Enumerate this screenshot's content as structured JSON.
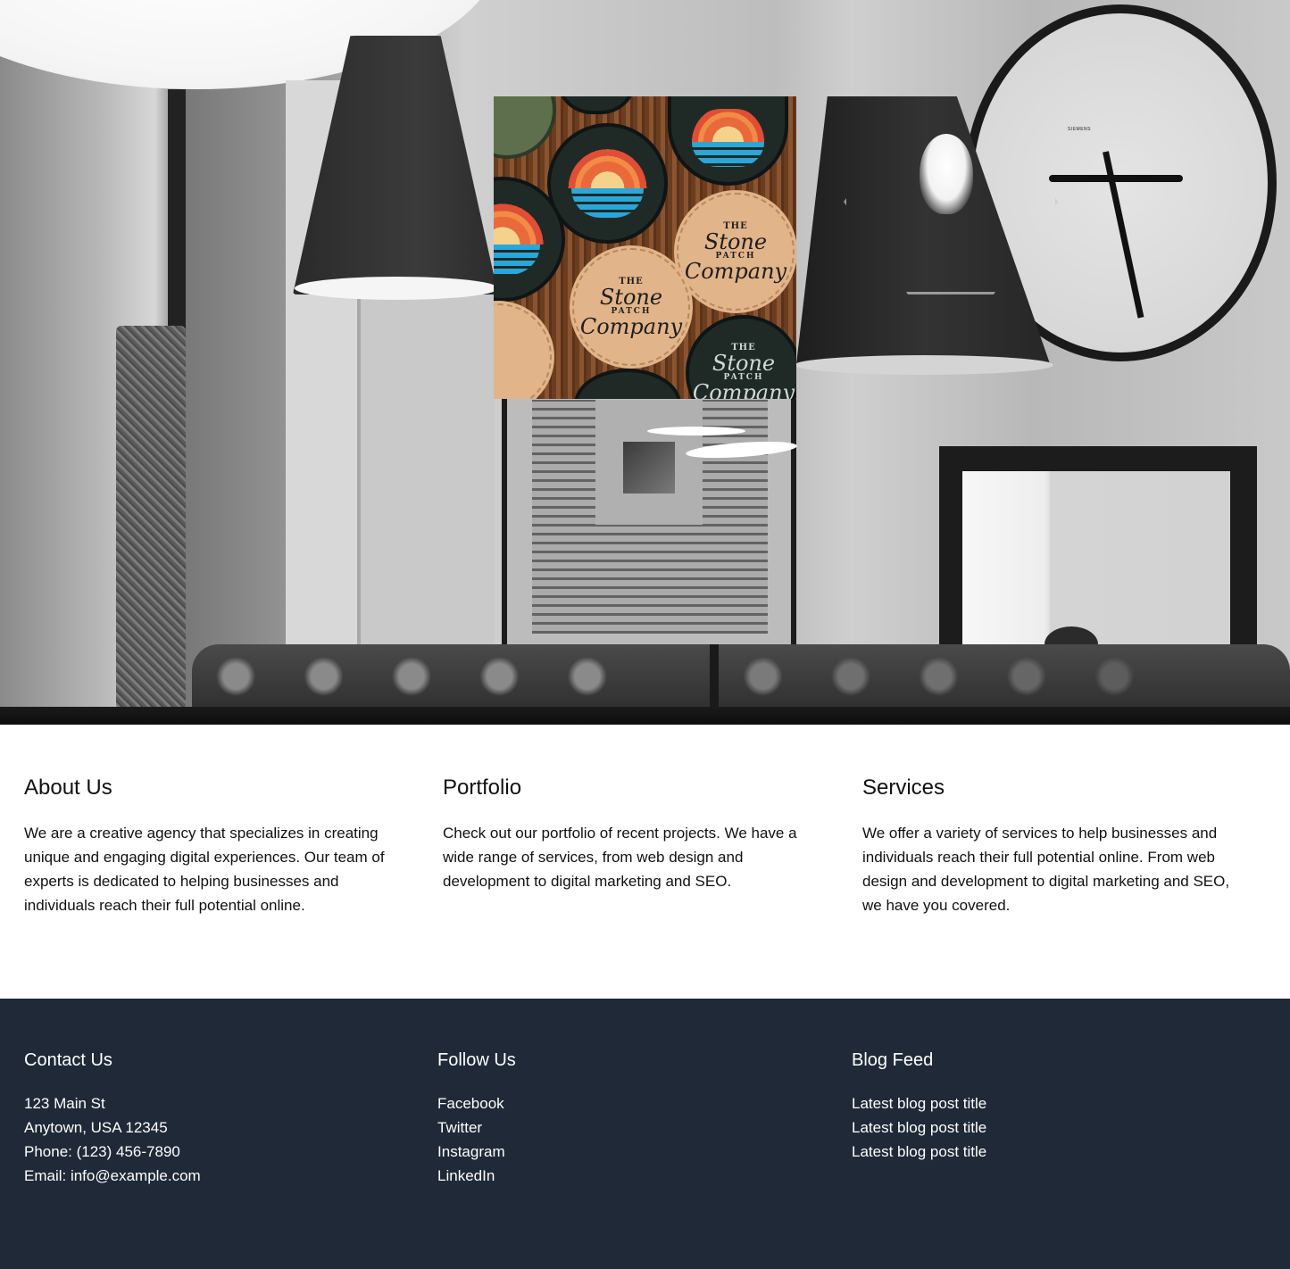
{
  "hero": {
    "background": "black-and-white interior photo with pendant lamps, wall clock, framed art, mirror and sofa",
    "clock_brand": "SIEMENS",
    "logo": {
      "alt": "The Stone Patch Company patches",
      "patch_the": "THE",
      "patch_name": "Stone",
      "patch_mid": "PATCH",
      "patch_company": "Company"
    }
  },
  "sections": [
    {
      "title": "About Us",
      "body": "We are a creative agency that specializes in creating unique and engaging digital experiences. Our team of experts is dedicated to helping businesses and individuals reach their full potential online."
    },
    {
      "title": "Portfolio",
      "body": "Check out our portfolio of recent projects. We have a wide range of services, from web design and development to digital marketing and SEO."
    },
    {
      "title": "Services",
      "body": "We offer a variety of services to help businesses and individuals reach their full potential online. From web design and development to digital marketing and SEO, we have you covered."
    }
  ],
  "footer": {
    "contact": {
      "title": "Contact Us",
      "lines": [
        "123 Main St",
        "Anytown, USA 12345",
        "Phone: (123) 456-7890",
        "Email: info@example.com"
      ]
    },
    "follow": {
      "title": "Follow Us",
      "links": [
        "Facebook",
        "Twitter",
        "Instagram",
        "LinkedIn"
      ]
    },
    "blog": {
      "title": "Blog Feed",
      "posts": [
        "Latest blog post title",
        "Latest blog post title",
        "Latest blog post title"
      ]
    },
    "background_color": "#1f2937",
    "text_color": "#ffffff"
  }
}
